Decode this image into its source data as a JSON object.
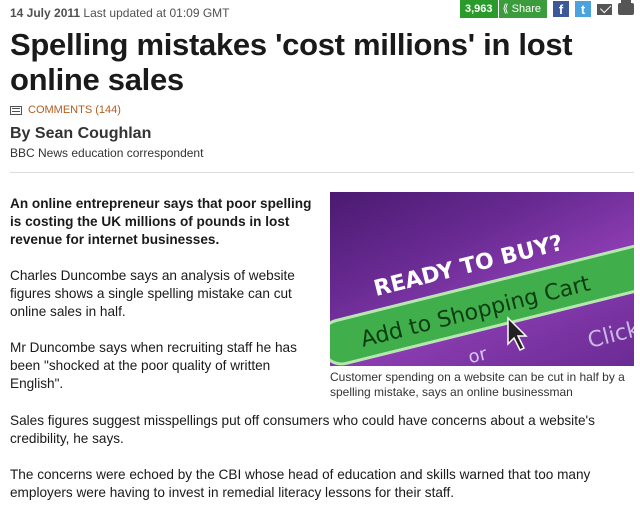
{
  "meta": {
    "date": "14 July 2011",
    "updated": "Last updated at 01:09 GMT"
  },
  "share": {
    "count": "3,963",
    "label": "Share",
    "icons": [
      "facebook-icon",
      "twitter-icon",
      "email-icon",
      "print-icon"
    ],
    "facebook_glyph": "f",
    "twitter_glyph": "t"
  },
  "headline": "Spelling mistakes 'cost millions' in lost online sales",
  "comments": {
    "label": "COMMENTS (144)"
  },
  "byline": {
    "author": "By Sean Coughlan",
    "role": "BBC News education correspondent"
  },
  "story": {
    "intro": "An online entrepreneur says that poor spelling is costing the UK millions of pounds in lost revenue for internet businesses.",
    "p1": "Charles Duncombe says an analysis of website figures shows a single spelling mistake can cut online sales in half.",
    "p2": "Mr Duncombe says when recruiting staff he has been \"shocked at the poor quality of written English\".",
    "p3": "Sales figures suggest misspellings put off consumers who could have concerns about a website's credibility, he says.",
    "p4": "The concerns were echoed by the CBI whose head of education and skills warned that too many employers were having to invest in remedial literacy lessons for their staff."
  },
  "image": {
    "text_ready": "READY TO BUY?",
    "text_button": "Add to Shopping Cart",
    "text_or": "or",
    "text_click": "Click",
    "caption": "Customer spending on a website can be cut in half by a spelling mistake, says an online businessman"
  }
}
